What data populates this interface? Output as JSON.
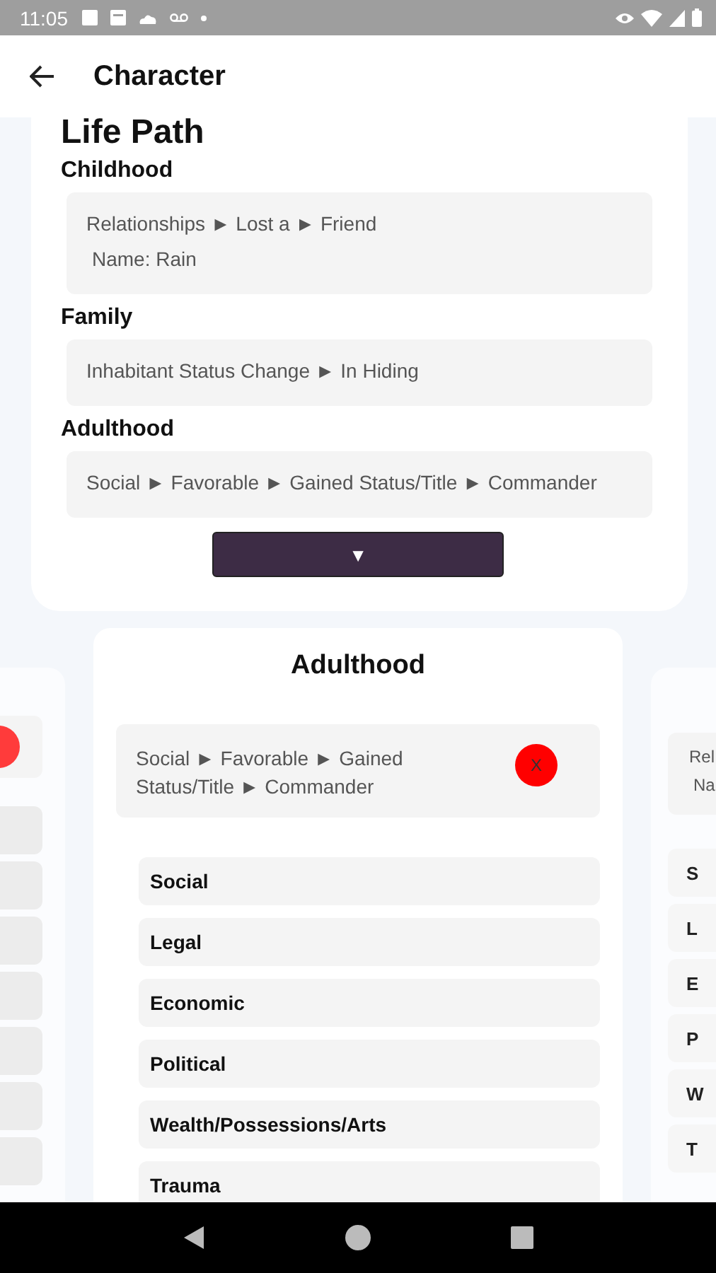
{
  "status_bar": {
    "time": "11:05"
  },
  "app_bar": {
    "title": "Character"
  },
  "life_path": {
    "title": "Life Path",
    "sections": [
      {
        "heading": "Childhood",
        "lines": [
          "Relationships ► Lost a ► Friend",
          "Name: Rain"
        ]
      },
      {
        "heading": "Family",
        "lines": [
          "Inhabitant Status Change ► In Hiding"
        ]
      },
      {
        "heading": "Adulthood",
        "lines": [
          "Social ► Favorable ► Gained Status/Title ► Commander"
        ]
      }
    ],
    "expand_button": "▼"
  },
  "previous_card": {
    "remove_button": true
  },
  "current_card": {
    "title": "Adulthood",
    "choice": "Social ► Favorable ► Gained Status/Title ► Commander",
    "remove_label": "X",
    "options": [
      "Social",
      "Legal",
      "Economic",
      "Political",
      "Wealth/Possessions/Arts",
      "Trauma"
    ]
  },
  "next_card": {
    "lines": [
      "Rel",
      "Na"
    ],
    "options": [
      "S",
      "L",
      "E",
      "P",
      "W",
      "T"
    ]
  }
}
